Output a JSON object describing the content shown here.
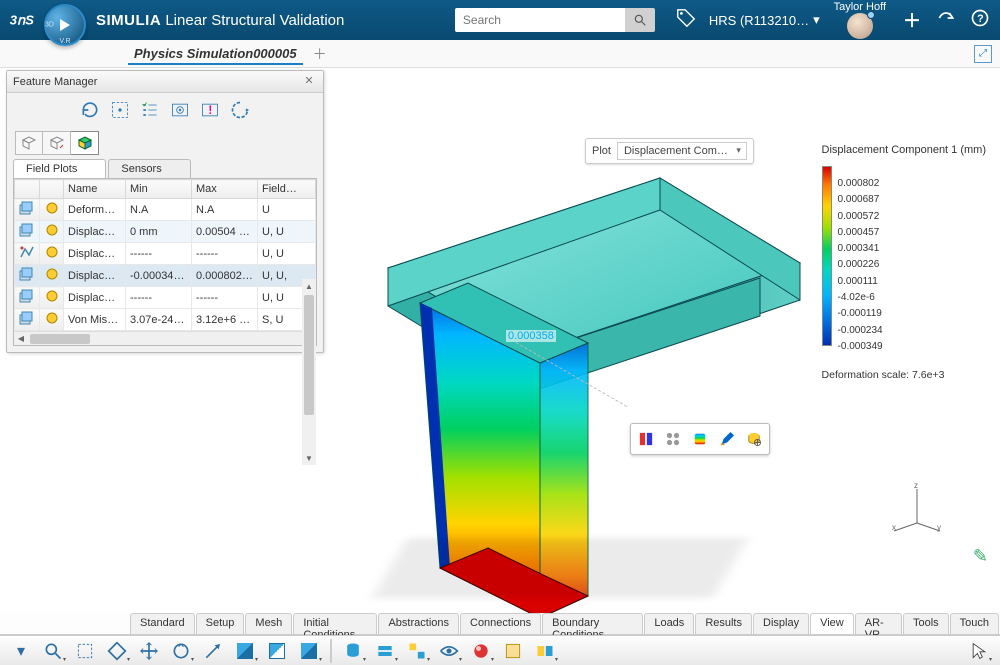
{
  "topbar": {
    "brand_short": "3DS",
    "app_label_bold": "SIMULIA",
    "app_label_rest": "Linear Structural Validation",
    "search_placeholder": "Search",
    "hrs_label": "HRS (R113210…",
    "user_name": "Taylor Hoff"
  },
  "crumb": {
    "doc_name": "Physics Simulation000005"
  },
  "feature_manager": {
    "title": "Feature Manager",
    "tabs": [
      "Field Plots",
      "Sensors"
    ],
    "columns": [
      "",
      "",
      "Name",
      "Min",
      "Max",
      "Field…"
    ],
    "rows": [
      {
        "name": "Deformat…",
        "min": "N.A",
        "max": "N.A",
        "field": "U"
      },
      {
        "name": "Displace…",
        "min": "0 mm",
        "max": "0.00504 mm",
        "field": "U, U"
      },
      {
        "name": "Displace…",
        "min": "------",
        "max": "------",
        "field": "U, U"
      },
      {
        "name": "Displace…",
        "min": "-0.000349 …",
        "max": "0.000802 …",
        "field": "U, U,",
        "selected": true
      },
      {
        "name": "Displace…",
        "min": "------",
        "max": "------",
        "field": "U, U"
      },
      {
        "name": "Von Mises…",
        "min": "3.07e-24 …",
        "max": "3.12e+6 …",
        "field": "S, U"
      }
    ]
  },
  "plot_dropdown": {
    "label": "Plot",
    "selected": "Displacement Com…"
  },
  "legend": {
    "title": "Displacement Component 1 (mm)",
    "ticks": [
      "0.000802",
      "0.000687",
      "0.000572",
      "0.000457",
      "0.000341",
      "0.000226",
      "0.000111",
      "-4.02e-6",
      "-0.000119",
      "-0.000234",
      "-0.000349"
    ],
    "deformation_scale": "Deformation scale: 7.6e+3"
  },
  "probe": {
    "value": "0.000358"
  },
  "bottom_tabs": [
    "Standard",
    "Setup",
    "Mesh",
    "Initial Conditions",
    "Abstractions",
    "Connections",
    "Boundary Conditions",
    "Loads",
    "Results",
    "Display",
    "View",
    "AR-VR",
    "Tools",
    "Touch"
  ],
  "bottom_active_tab": "View",
  "chart_data": {
    "type": "colormap-legend",
    "title": "Displacement Component 1 (mm)",
    "min": -0.000349,
    "max": 0.000802,
    "ticks": [
      0.000802,
      0.000687,
      0.000572,
      0.000457,
      0.000341,
      0.000226,
      0.000111,
      -4.02e-06,
      -0.000119,
      -0.000234,
      -0.000349
    ],
    "colormap": "rainbow",
    "deformation_scale": 7600
  }
}
